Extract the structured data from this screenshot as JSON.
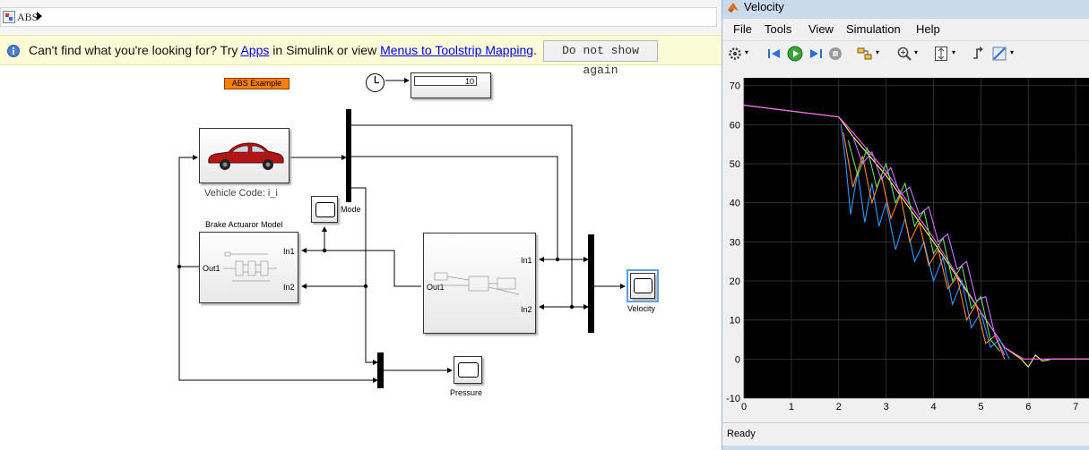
{
  "breadcrumb": {
    "model": "ABS"
  },
  "notice": {
    "prefix": "Can't find what you're looking for? Try ",
    "apps_link": "Apps",
    "middle": " in Simulink or view ",
    "menus_link": "Menus to Toolstrip Mapping",
    "suffix": ".",
    "dismiss_label": "Do not show again"
  },
  "diagram": {
    "annotation": "ABS Example",
    "display_value": "10",
    "vehicle_label": "Vehicle Code: i_i",
    "brake_title": "Brake Actuaror Model",
    "brake_out": "Out1",
    "brake_in1": "In1",
    "brake_in2": "In2",
    "mode_label": "Mode",
    "sub_out": "Out1",
    "sub_in1": "In1",
    "sub_in2": "In2",
    "velocity_label": "Velocity",
    "pressure_label": "Pressure"
  },
  "scope_window": {
    "title": "Velocity",
    "menu": [
      "File",
      "Tools",
      "View",
      "Simulation",
      "Help"
    ],
    "status": "Ready",
    "colors": {
      "background": "#000000",
      "grid": "#3a3a3a",
      "axis_text": "#ffffff"
    }
  },
  "chart_data": {
    "type": "line",
    "title": "",
    "xlabel": "",
    "ylabel": "",
    "xlim": [
      0,
      7.3
    ],
    "ylim": [
      -10,
      72
    ],
    "xticks": [
      0,
      1,
      2,
      3,
      4,
      5,
      6,
      7
    ],
    "yticks": [
      -10,
      0,
      10,
      20,
      30,
      40,
      50,
      60,
      70
    ],
    "grid": true,
    "series": [
      {
        "color": "#ffff66",
        "x": [
          0,
          2,
          2.3,
          3,
          4,
          5,
          5.5,
          5.85,
          6.0,
          6.15,
          6.3,
          6.5,
          7.3
        ],
        "y": [
          65,
          62,
          57,
          47,
          30,
          12,
          3,
          0,
          -2,
          1,
          -0.5,
          0,
          0
        ]
      },
      {
        "color": "#ff66ff",
        "x": [
          0,
          2,
          2.3,
          3,
          4,
          5,
          5.5,
          5.9,
          6.3,
          7.3
        ],
        "y": [
          65,
          62,
          58,
          48,
          31,
          12,
          3,
          0,
          0,
          0
        ]
      },
      {
        "color": "#3399ff",
        "x": [
          2.05,
          2.15,
          2.25,
          2.4,
          2.55,
          2.7,
          2.85,
          3.0,
          3.2,
          3.4,
          3.6,
          3.8,
          4.0,
          4.2,
          4.4,
          4.6,
          4.8,
          5.0,
          5.2,
          5.4,
          5.6
        ],
        "y": [
          60,
          50,
          37,
          48,
          35,
          45,
          34,
          40,
          28,
          36,
          25,
          30,
          20,
          26,
          14,
          20,
          8,
          12,
          3,
          5,
          0
        ]
      },
      {
        "color": "#ff8833",
        "x": [
          2.1,
          2.3,
          2.5,
          2.7,
          2.9,
          3.1,
          3.3,
          3.5,
          3.7,
          3.9,
          4.1,
          4.3,
          4.5,
          4.7,
          4.9,
          5.1,
          5.3,
          5.5
        ],
        "y": [
          58,
          44,
          52,
          40,
          47,
          36,
          42,
          30,
          35,
          24,
          28,
          18,
          21,
          10,
          14,
          4,
          6,
          0
        ]
      },
      {
        "color": "#66dd66",
        "x": [
          2.2,
          2.4,
          2.6,
          2.8,
          3.0,
          3.2,
          3.4,
          3.6,
          3.8,
          4.0,
          4.2,
          4.4,
          4.6,
          4.8,
          5.0,
          5.2,
          5.4
        ],
        "y": [
          56,
          47,
          54,
          44,
          50,
          40,
          45,
          34,
          38,
          27,
          31,
          20,
          24,
          13,
          16,
          5,
          2
        ]
      },
      {
        "color": "#cc77ff",
        "x": [
          2.3,
          2.5,
          2.7,
          2.9,
          3.1,
          3.3,
          3.5,
          3.7,
          3.9,
          4.1,
          4.3,
          4.5,
          4.7,
          4.9,
          5.1,
          5.3,
          5.5
        ],
        "y": [
          57,
          50,
          53,
          46,
          49,
          42,
          44,
          37,
          39,
          30,
          32,
          23,
          25,
          15,
          16,
          6,
          1
        ]
      }
    ]
  }
}
